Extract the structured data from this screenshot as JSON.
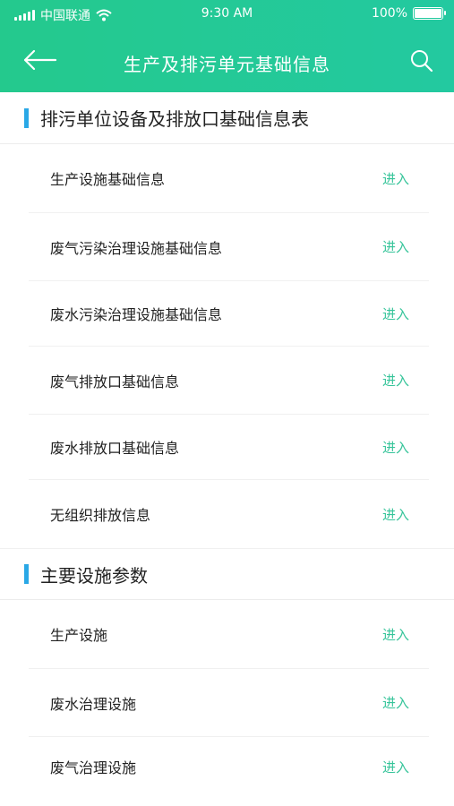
{
  "status": {
    "carrier": "中国联通",
    "time": "9:30 AM",
    "battery": "100%",
    "battery_level": 1.0
  },
  "nav": {
    "title": "生产及排污单元基础信息",
    "back_icon": "arrow-left-icon",
    "search_icon": "search-icon"
  },
  "colors": {
    "header": "#24c98d",
    "accent_bar": "#2aa8e6",
    "enter_link": "#36c49a"
  },
  "sections": [
    {
      "title": "排污单位设备及排放口基础信息表",
      "items": [
        {
          "label": "生产设施基础信息",
          "action": "进入"
        },
        {
          "label": "废气污染治理设施基础信息",
          "action": "进入"
        },
        {
          "label": "废水污染治理设施基础信息",
          "action": "进入"
        },
        {
          "label": "废气排放口基础信息",
          "action": "进入"
        },
        {
          "label": "废水排放口基础信息",
          "action": "进入"
        },
        {
          "label": "无组织排放信息",
          "action": "进入"
        }
      ]
    },
    {
      "title": "主要设施参数",
      "items": [
        {
          "label": "生产设施",
          "action": "进入"
        },
        {
          "label": "废水治理设施",
          "action": "进入"
        },
        {
          "label": "废气治理设施",
          "action": "进入"
        }
      ]
    }
  ]
}
